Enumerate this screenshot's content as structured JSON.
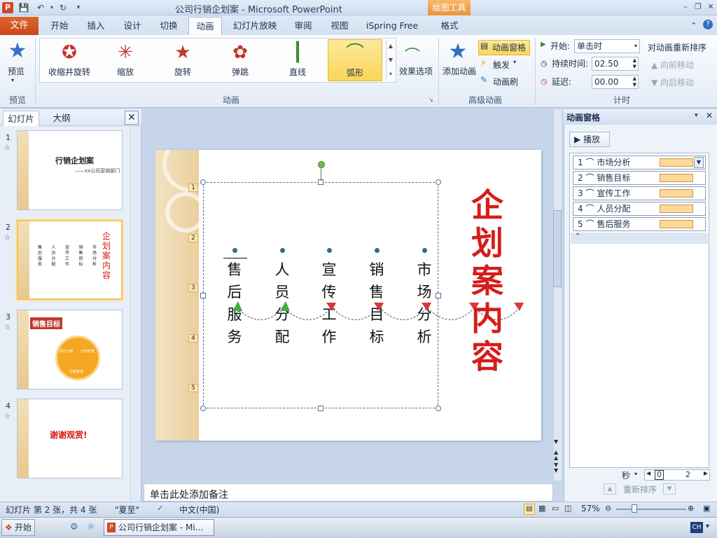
{
  "titlebar": {
    "title": "公司行销企划案 - Microsoft PowerPoint",
    "context_tab": "绘图工具"
  },
  "tabs": {
    "file": "文件",
    "items": [
      "开始",
      "插入",
      "设计",
      "切换",
      "动画",
      "幻灯片放映",
      "审阅",
      "视图",
      "iSpring Free",
      "格式"
    ],
    "active": "动画"
  },
  "ribbon": {
    "preview": {
      "label": "预览",
      "group": "预览"
    },
    "animations": {
      "group": "动画",
      "items": [
        "收缩并旋转",
        "缩放",
        "旋转",
        "弹跳",
        "直线",
        "弧形"
      ],
      "selected": "弧形",
      "effect_options": "效果选项"
    },
    "advanced": {
      "group": "高级动画",
      "add_animation": "添加动画",
      "animation_pane": "动画窗格",
      "trigger": "触发",
      "painter": "动画刷"
    },
    "timing": {
      "group": "计时",
      "start_label": "开始:",
      "start_value": "单击时",
      "duration_label": "持续时间:",
      "duration_value": "02.50",
      "delay_label": "延迟:",
      "delay_value": "00.00",
      "reorder_title": "对动画重新排序",
      "move_earlier": "向前移动",
      "move_later": "向后移动"
    }
  },
  "left_panel": {
    "tabs": [
      "幻灯片",
      "大纲"
    ],
    "slides": [
      {
        "num": "1",
        "title": "行销企划案",
        "subtitle": "——xx公司营销部门"
      },
      {
        "num": "2",
        "title": "企划案内容",
        "cols": [
          "售后服务",
          "人员分配",
          "宣传工作",
          "销售目标",
          "市场分析"
        ]
      },
      {
        "num": "3",
        "title": "销售目标",
        "segments": [
          "同行分析",
          "公司背景",
          "方案管理"
        ]
      },
      {
        "num": "4",
        "title": "谢谢观赏!"
      }
    ]
  },
  "slide": {
    "title": "企划案内容",
    "columns": [
      "售后服务",
      "人员分配",
      "宣传工作",
      "销售目标",
      "市场分析"
    ],
    "number_tags": [
      "1",
      "2",
      "3",
      "4",
      "5"
    ]
  },
  "notes": {
    "placeholder": "单击此处添加备注"
  },
  "anim_pane": {
    "title": "动画窗格",
    "play": "播放",
    "items": [
      {
        "idx": "1",
        "name": "市场分析"
      },
      {
        "idx": "2",
        "name": "销售目标"
      },
      {
        "idx": "3",
        "name": "宣传工作"
      },
      {
        "idx": "4",
        "name": "人员分配"
      },
      {
        "idx": "5",
        "name": "售后服务"
      }
    ],
    "seconds_label": "秒",
    "timeline_start": "0",
    "timeline_end": "2",
    "reorder": "重新排序"
  },
  "statusbar": {
    "slide_info": "幻灯片 第 2 张，共 4 张",
    "theme": "\"夏至\"",
    "language": "中文(中国)",
    "zoom": "57%"
  },
  "taskbar": {
    "start": "开始",
    "task": "公司行销企划案 - Mi...",
    "ime": "CH"
  }
}
